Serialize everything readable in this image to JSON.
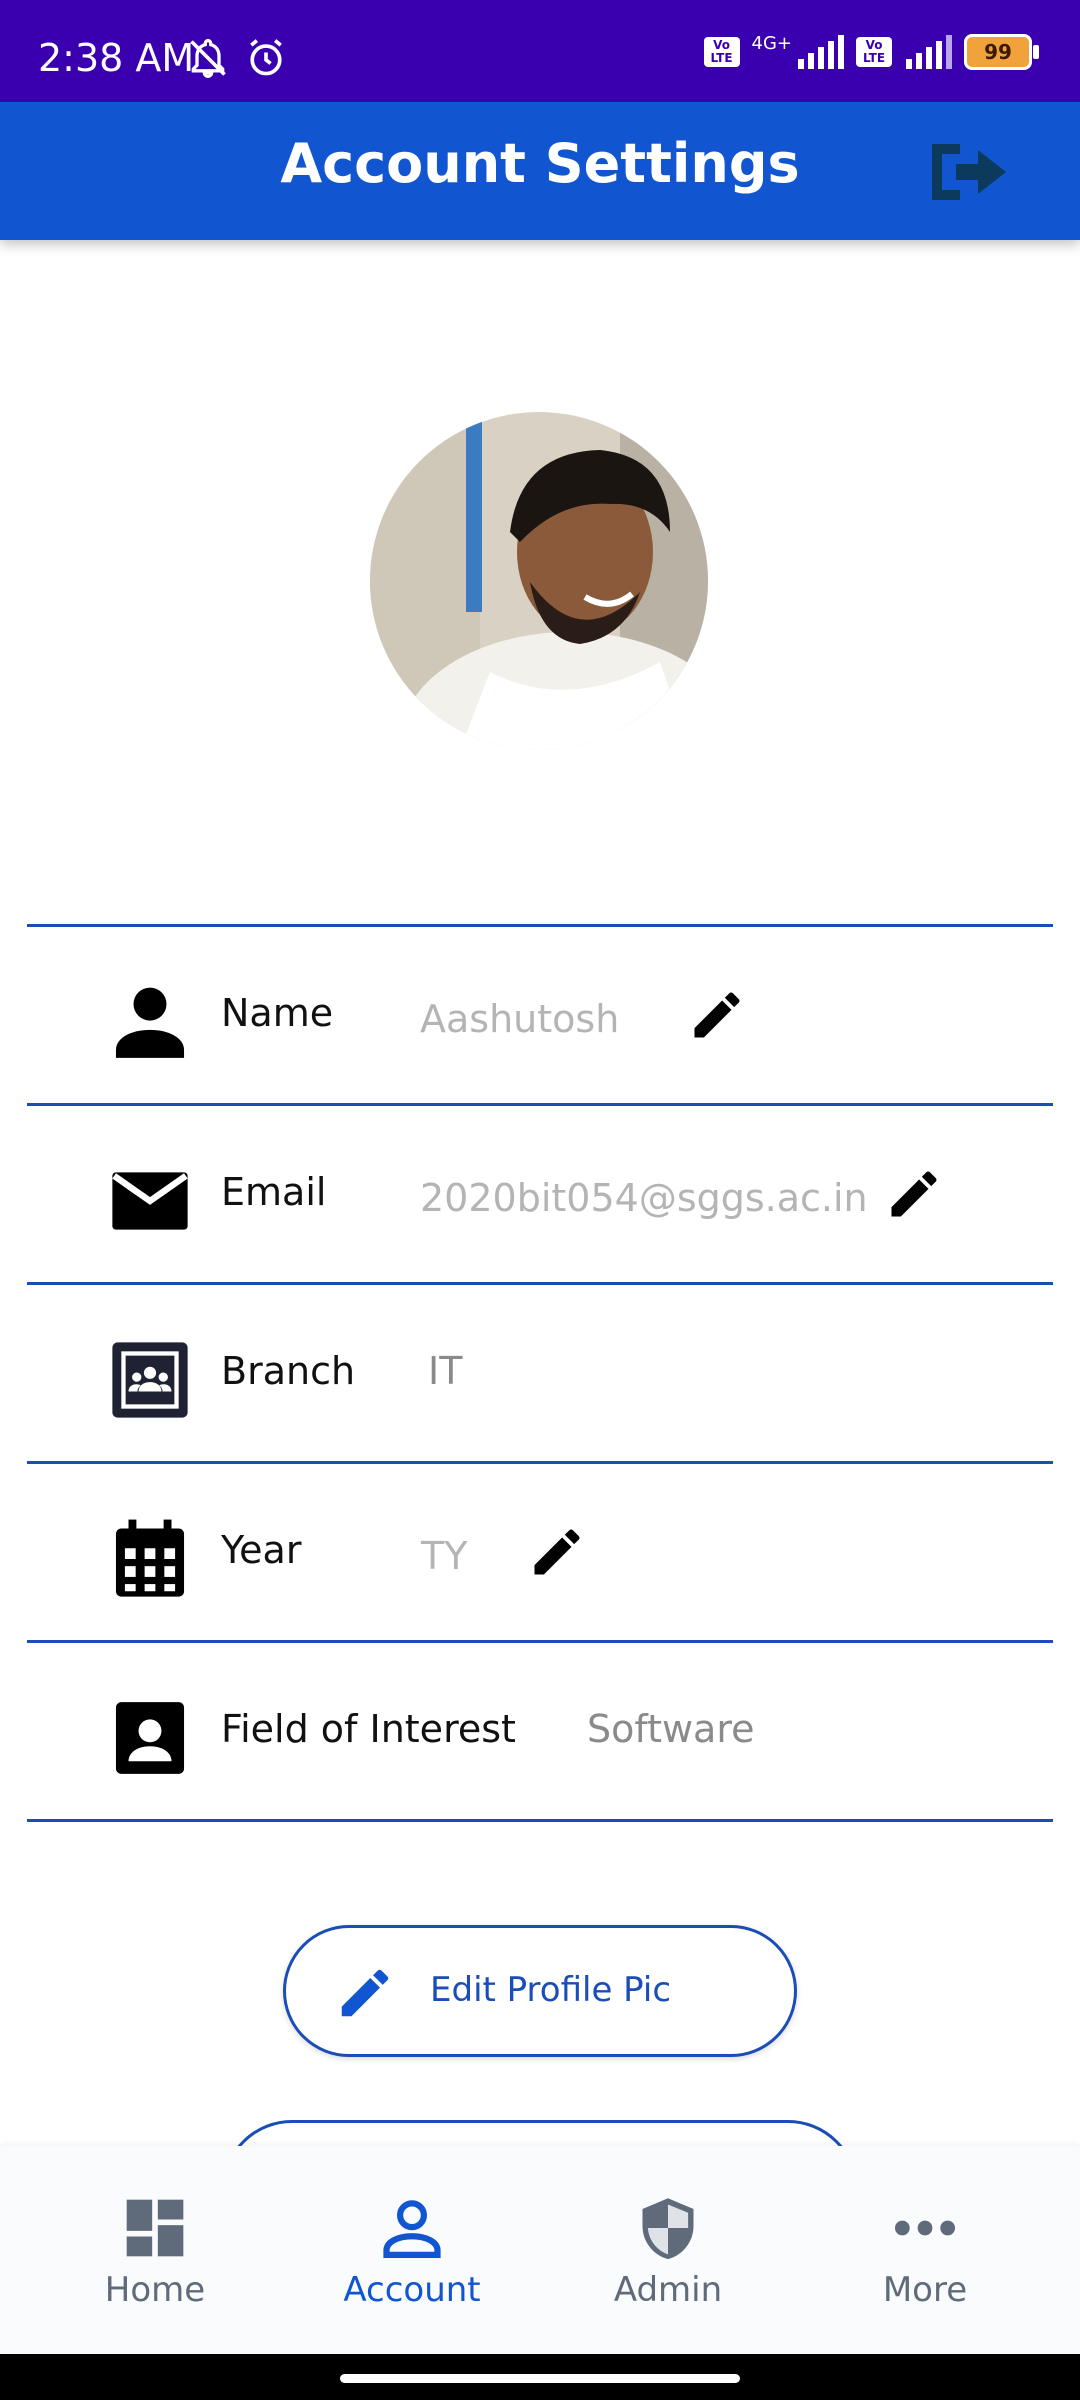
{
  "status_bar": {
    "time": "2:38 AM",
    "network": "4G+",
    "volte": "Vo LTE",
    "battery": "99"
  },
  "app_bar": {
    "title": "Account Settings"
  },
  "profile": {
    "fields": [
      {
        "label": "Name",
        "value": "Aashutosh",
        "icon": "person-icon"
      },
      {
        "label": "Email",
        "value": "2020bit054@sggs.ac.in",
        "icon": "mail-icon"
      },
      {
        "label": "Branch",
        "value": "IT",
        "icon": "classroom-icon"
      },
      {
        "label": "Year",
        "value": "TY",
        "icon": "calendar-icon"
      },
      {
        "label": "Field of Interest",
        "value": "Software",
        "icon": "badge-icon"
      }
    ]
  },
  "actions": {
    "edit_profile_pic": "Edit Profile Pic"
  },
  "bottom_nav": {
    "items": [
      {
        "label": "Home",
        "icon": "dashboard-icon"
      },
      {
        "label": "Account",
        "icon": "account-icon"
      },
      {
        "label": "Admin",
        "icon": "shield-icon"
      },
      {
        "label": "More",
        "icon": "more-icon"
      }
    ],
    "active": "Account"
  },
  "colors": {
    "status_bar": "#3a00b0",
    "primary": "#1156d0",
    "divider": "#1a4db8",
    "nav_inactive": "#5f6b7a"
  }
}
